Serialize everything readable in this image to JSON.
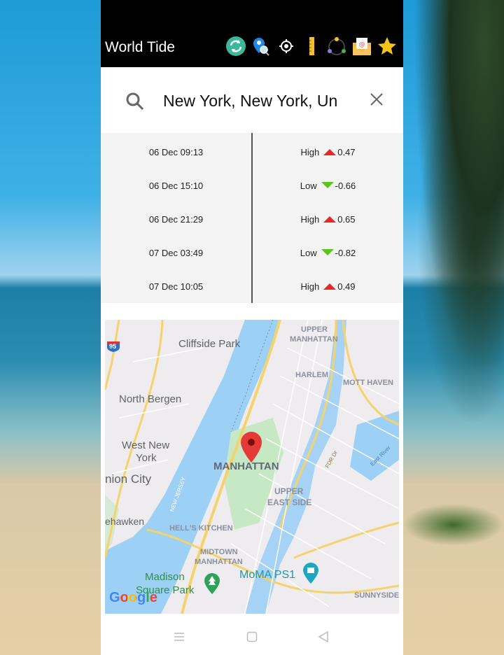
{
  "app": {
    "title": "World Tide"
  },
  "toolbar": {
    "icons": [
      "refresh-icon",
      "location-search-icon",
      "gps-target-icon",
      "ruler-icon",
      "share-network-icon",
      "email-icon",
      "star-icon"
    ]
  },
  "search": {
    "value": "New York, New York, Un",
    "clear_label": "×"
  },
  "tides": [
    {
      "datetime": "06 Dec 09:13",
      "type": "High",
      "direction": "up",
      "value": "0.47"
    },
    {
      "datetime": "06 Dec 15:10",
      "type": "Low",
      "direction": "down",
      "value": "-0.66"
    },
    {
      "datetime": "06 Dec 21:29",
      "type": "High",
      "direction": "up",
      "value": "0.65"
    },
    {
      "datetime": "07 Dec 03:49",
      "type": "Low",
      "direction": "down",
      "value": "-0.82"
    },
    {
      "datetime": "07 Dec 10:05",
      "type": "High",
      "direction": "up",
      "value": "0.49"
    }
  ],
  "colors": {
    "high": "#e52828",
    "low": "#5cc21f",
    "water": "#9dd0f5",
    "park": "#c6e8c4",
    "road": "#f6d36a"
  },
  "map": {
    "labels": {
      "highway": "95",
      "cliffside": "Cliffside Park",
      "upper_manhattan_1": "UPPER",
      "upper_manhattan_2": "MANHATTAN",
      "harlem": "HARLEM",
      "mott_haven": "MOTT HAVEN",
      "north_bergen": "North Bergen",
      "west_new_york_1": "West New",
      "west_new_york_2": "York",
      "union_city": "nion City",
      "manhattan": "MANHATTAN",
      "fdr": "FDR Dr",
      "east_river": "East River",
      "new_jersey": "NEW JERSEY",
      "upper_east_1": "UPPER",
      "upper_east_2": "EAST SIDE",
      "weehawken": "ehawken",
      "hells_kitchen": "HELL'S KITCHEN",
      "midtown_1": "MIDTOWN",
      "midtown_2": "MANHATTAN",
      "madison_1": "Madison",
      "madison_2": "Square Park",
      "moma": "MoMA PS1",
      "sunnyside": "SUNNYSIDE",
      "google": "Google"
    }
  },
  "navbar": {
    "items": [
      "menu",
      "home",
      "back"
    ]
  }
}
